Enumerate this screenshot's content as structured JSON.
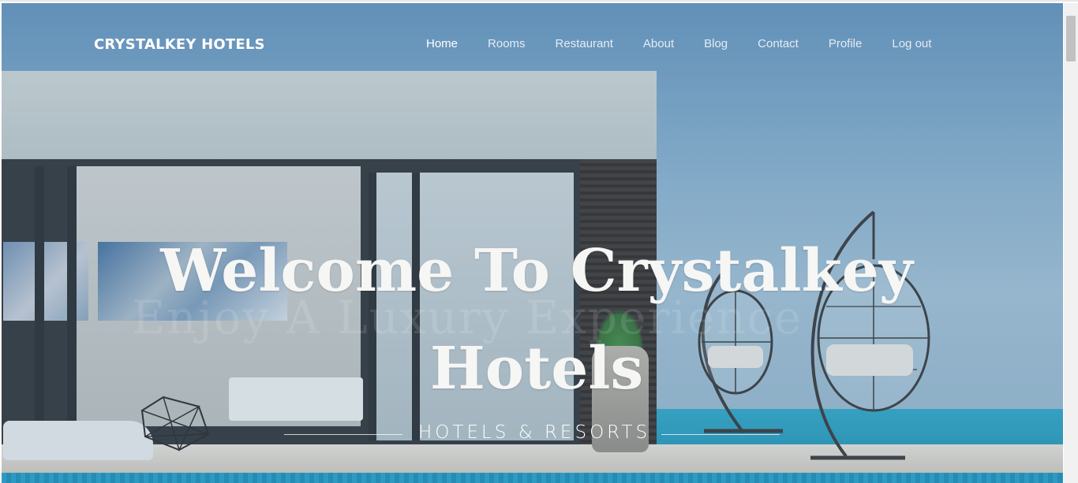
{
  "brand": {
    "name": "CRYSTALKEY HOTELS"
  },
  "nav": {
    "items": [
      {
        "label": "Home",
        "active": true
      },
      {
        "label": "Rooms"
      },
      {
        "label": "Restaurant"
      },
      {
        "label": "About"
      },
      {
        "label": "Blog"
      },
      {
        "label": "Contact"
      },
      {
        "label": "Profile"
      },
      {
        "label": "Log out"
      }
    ]
  },
  "hero": {
    "title_line1": "Welcome To Crystalkey",
    "title_line2": "Hotels",
    "subtitle": "HOTELS & RESORTS",
    "watermark": "Enjoy A Luxury Experience"
  },
  "colors": {
    "sky": "#6e96b9",
    "text": "#ffffff",
    "pool": "#1f9cc6"
  }
}
